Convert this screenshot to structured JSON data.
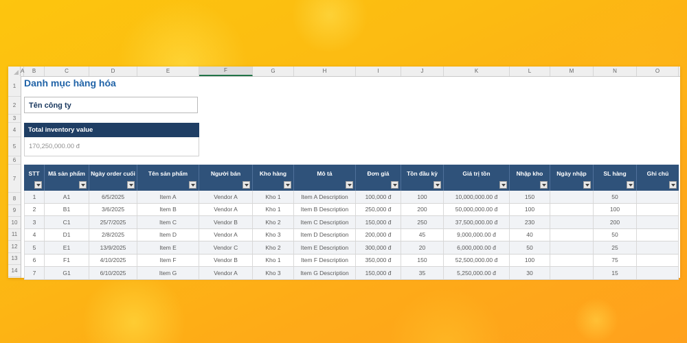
{
  "spreadsheet": {
    "column_letters": [
      "A",
      "B",
      "C",
      "D",
      "E",
      "F",
      "G",
      "H",
      "I",
      "J",
      "K",
      "L",
      "M",
      "N",
      "O"
    ],
    "selected_column": "F",
    "row_numbers": [
      "1",
      "2",
      "3",
      "4",
      "5",
      "6",
      "7",
      "8",
      "9",
      "10",
      "11",
      "12",
      "13",
      "14"
    ],
    "title": "Danh mục hàng hóa",
    "company_field": "Tên công ty",
    "summary": {
      "label": "Total inventory value",
      "value": "170,250,000.00 đ"
    },
    "table": {
      "headers": [
        "STT",
        "Mã sản phẩm",
        "Ngày order cuối",
        "Tên sản phẩm",
        "Người bán",
        "Kho hàng",
        "Mô tả",
        "Đơn giá",
        "Tồn đầu kỳ",
        "Giá trị tồn",
        "Nhập kho",
        "Ngày nhập",
        "SL hàng",
        "Ghi chú"
      ],
      "rows": [
        [
          "1",
          "A1",
          "6/5/2025",
          "Item A",
          "Vendor A",
          "Kho 1",
          "Item A Description",
          "100,000 đ",
          "100",
          "10,000,000.00 đ",
          "150",
          "",
          "50",
          ""
        ],
        [
          "2",
          "B1",
          "3/6/2025",
          "Item B",
          "Vendor A",
          "Kho 1",
          "Item B Description",
          "250,000 đ",
          "200",
          "50,000,000.00 đ",
          "100",
          "",
          "100",
          ""
        ],
        [
          "3",
          "C1",
          "25/7/2025",
          "Item C",
          "Vendor B",
          "Kho 2",
          "Item C Description",
          "150,000 đ",
          "250",
          "37,500,000.00 đ",
          "230",
          "",
          "200",
          ""
        ],
        [
          "4",
          "D1",
          "2/8/2025",
          "Item D",
          "Vendor A",
          "Kho 3",
          "Item D Description",
          "200,000 đ",
          "45",
          "9,000,000.00 đ",
          "40",
          "",
          "50",
          ""
        ],
        [
          "5",
          "E1",
          "13/9/2025",
          "Item E",
          "Vendor C",
          "Kho 2",
          "Item E Description",
          "300,000 đ",
          "20",
          "6,000,000.00 đ",
          "50",
          "",
          "25",
          ""
        ],
        [
          "6",
          "F1",
          "4/10/2025",
          "Item F",
          "Vendor B",
          "Kho 1",
          "Item F Description",
          "350,000 đ",
          "150",
          "52,500,000.00 đ",
          "100",
          "",
          "75",
          ""
        ],
        [
          "7",
          "G1",
          "6/10/2025",
          "Item G",
          "Vendor A",
          "Kho 3",
          "Item G Description",
          "150,000 đ",
          "35",
          "5,250,000.00 đ",
          "30",
          "",
          "15",
          ""
        ]
      ]
    },
    "colors": {
      "background_orange": "#ffa11d",
      "background_yellow": "#fdc50e",
      "table_header_navy": "#2f527a",
      "banner_navy": "#1f3e64",
      "title_blue": "#2063a7",
      "selected_column_green": "#217346"
    }
  }
}
